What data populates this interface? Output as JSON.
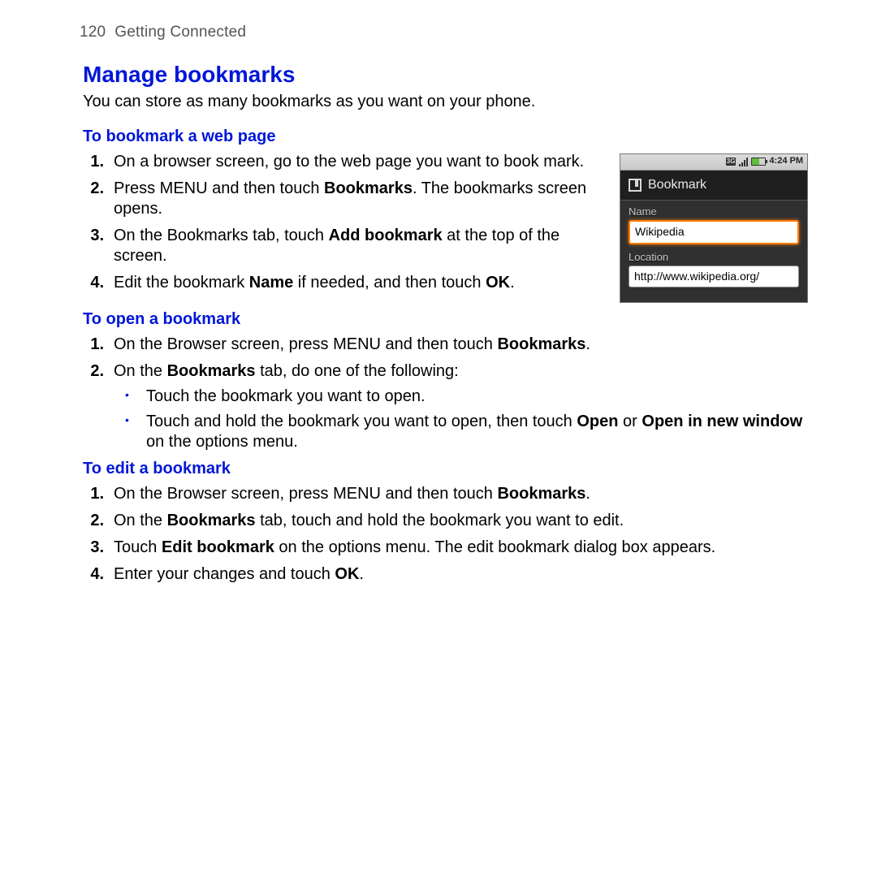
{
  "header": {
    "page_number": "120",
    "chapter": "Getting Connected"
  },
  "title": "Manage bookmarks",
  "intro": "You can store as many bookmarks as you want on your phone.",
  "sections": {
    "bookmark_page": {
      "heading": "To bookmark a web page",
      "steps": {
        "s1": "On a browser screen, go to the web page you want to book mark.",
        "s2a": "Press MENU and then touch ",
        "s2b": "Bookmarks",
        "s2c": ". The bookmarks screen opens.",
        "s3a": "On the Bookmarks tab, touch ",
        "s3b": "Add bookmark",
        "s3c": " at the top of the screen.",
        "s4a": "Edit the bookmark ",
        "s4b": "Name",
        "s4c": " if needed, and then touch ",
        "s4d": "OK",
        "s4e": "."
      }
    },
    "open": {
      "heading": "To open a bookmark",
      "steps": {
        "s1a": "On the Browser screen, press MENU and then touch ",
        "s1b": "Bookmarks",
        "s1c": ".",
        "s2a": "On the ",
        "s2b": "Bookmarks",
        "s2c": " tab, do one of the following:"
      },
      "bullets": {
        "b1": "Touch the bookmark you want to open.",
        "b2a": "Touch and hold the bookmark you want to open, then touch ",
        "b2b": "Open",
        "b2c": " or ",
        "b2d": "Open in new window",
        "b2e": " on the options menu."
      }
    },
    "edit": {
      "heading": "To edit a bookmark",
      "steps": {
        "s1a": "On the Browser screen, press MENU and then touch ",
        "s1b": "Bookmarks",
        "s1c": ".",
        "s2a": "On the ",
        "s2b": "Bookmarks",
        "s2c": " tab, touch and hold the bookmark you want to edit.",
        "s3a": "Touch ",
        "s3b": "Edit bookmark",
        "s3c": " on the options menu. The edit bookmark dialog box appears.",
        "s4a": "Enter your changes and touch ",
        "s4b": "OK",
        "s4c": "."
      }
    }
  },
  "phone": {
    "time": "4:24 PM",
    "network_badge": "3G",
    "dialog_title": "Bookmark",
    "name_label": "Name",
    "name_value": "Wikipedia",
    "location_label": "Location",
    "location_value": "http://www.wikipedia.org/"
  }
}
